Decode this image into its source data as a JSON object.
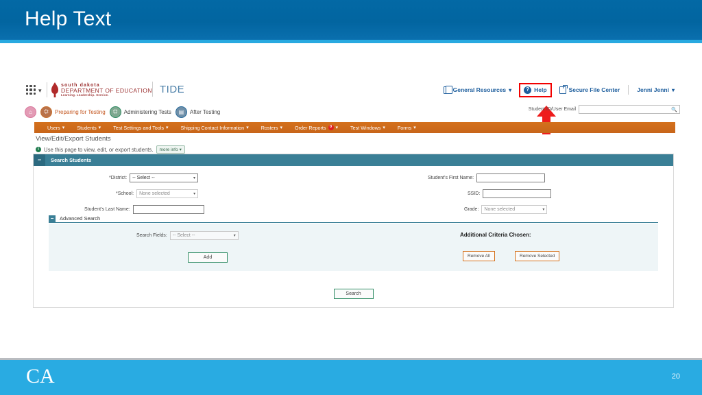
{
  "slide": {
    "title": "Help Text",
    "page_number": "20",
    "footer_logo": "CA",
    "header_color": "#0265a0",
    "accent_color": "#29a9e0",
    "footer_color": "#29abe2"
  },
  "app": {
    "brand": {
      "logo_line1": "south dakota",
      "logo_line2": "DEPARTMENT OF EDUCATION",
      "logo_line3": "Learning. Leadership. Service.",
      "product": "TIDE"
    },
    "topnav": {
      "items": [
        {
          "label": "General Resources",
          "caret": "⌄",
          "icon": "document-icon"
        },
        {
          "label": "Help",
          "caret": "",
          "icon": "help-circle-icon"
        },
        {
          "label": "Secure File Center",
          "caret": "",
          "icon": "secure-file-icon"
        },
        {
          "label": "Jenni Jenni",
          "caret": "⌄",
          "icon": ""
        }
      ],
      "highlight_color": "#f20000",
      "help_marker": "?"
    },
    "tasknav": {
      "items": [
        {
          "label": "",
          "icon": "home-icon",
          "glyph": "⌂",
          "color": "#e39bb5"
        },
        {
          "label": "Preparing for Testing",
          "icon": "prepare-icon",
          "glyph": "⛭",
          "color": "#c9712f"
        },
        {
          "label": "Administering Tests",
          "icon": "administer-icon",
          "glyph": "⛭",
          "color": "#2e8b63"
        },
        {
          "label": "After Testing",
          "icon": "after-testing-icon",
          "glyph": "▤",
          "color": "#2b6c9c"
        }
      ]
    },
    "student_lookup": {
      "label": "Student ID/User Email",
      "value": "",
      "placeholder": "",
      "icon": "magnifier-icon"
    },
    "menubar": {
      "items": [
        {
          "label": "Users",
          "caret": "⌄",
          "badge": ""
        },
        {
          "label": "Students",
          "caret": "⌄",
          "badge": ""
        },
        {
          "label": "Test Settings and Tools",
          "caret": "⌄",
          "badge": ""
        },
        {
          "label": "Shipping Contact Information",
          "caret": "⌄",
          "badge": ""
        },
        {
          "label": "Rosters",
          "caret": "⌄",
          "badge": ""
        },
        {
          "label": "Order Reports",
          "caret": "⌄",
          "badge": "0"
        },
        {
          "label": "Test Windows",
          "caret": "⌄",
          "badge": ""
        },
        {
          "label": "Forms",
          "caret": "⌄",
          "badge": ""
        }
      ],
      "bar_color": "#c8651a"
    },
    "page": {
      "title": "View/Edit/Export Students",
      "info_icon": "info-icon",
      "info_text": "Use this page to view, edit, or export students.",
      "more_info_label": "more info",
      "more_info_caret": "⌄"
    },
    "search_panel": {
      "title": "Search Students",
      "collapse_glyph": "−",
      "fields": {
        "district": {
          "label": "*District:",
          "value": "-- Select --",
          "caret": "⌄"
        },
        "school": {
          "label": "*School:",
          "value": "None selected",
          "caret": "▾"
        },
        "last_name": {
          "label": "Student's Last Name:",
          "value": ""
        },
        "first_name": {
          "label": "Student's First Name:",
          "value": ""
        },
        "ssid": {
          "label": "SSID:",
          "value": ""
        },
        "grade": {
          "label": "Grade:",
          "value": "None selected",
          "caret": "▾"
        }
      },
      "advanced": {
        "title": "Advanced Search",
        "collapse_glyph": "−",
        "search_fields_label": "Search Fields:",
        "search_fields_value": "-- Select --",
        "search_fields_caret": "▾",
        "add_label": "Add",
        "criteria_title": "Additional Criteria Chosen:",
        "remove_all_label": "Remove All",
        "remove_selected_label": "Remove Selected"
      },
      "search_label": "Search"
    }
  }
}
